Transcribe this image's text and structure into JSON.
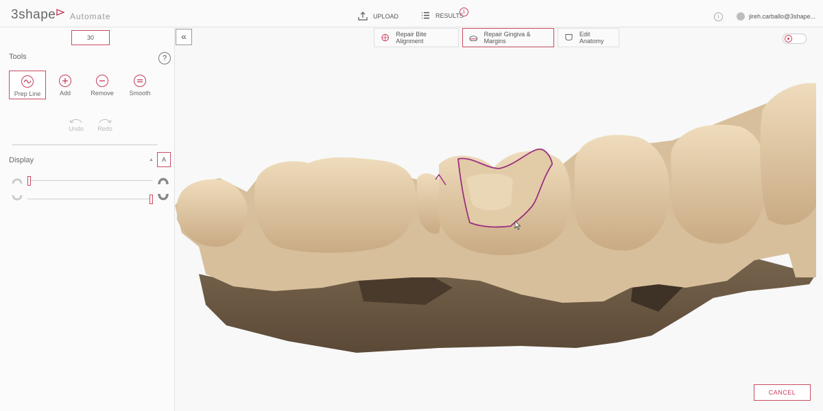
{
  "header": {
    "logo_text": "3shape",
    "app_name": "Automate",
    "upload_label": "UPLOAD",
    "results_label": "RESULTS",
    "results_count": "1",
    "user_email": "jireh.carballo@3shape..."
  },
  "sidebar": {
    "number_value": "30",
    "tools_title": "Tools",
    "tools": [
      {
        "label": "Prep Line",
        "icon": "prep-line-icon",
        "selected": true
      },
      {
        "label": "Add",
        "icon": "add-icon"
      },
      {
        "label": "Remove",
        "icon": "remove-icon"
      },
      {
        "label": "Smooth",
        "icon": "smooth-icon"
      }
    ],
    "undo_label": "Undo",
    "redo_label": "Redo",
    "display_title": "Display",
    "display_toggle_label": "A",
    "sliders": [
      {
        "icon": "arch-icon",
        "level": 0.0
      },
      {
        "icon": "arch-icon",
        "level": 1.0
      }
    ]
  },
  "modes": {
    "tabs": [
      {
        "label": "Repair Bite Alignment",
        "icon": "bite-alignment-icon"
      },
      {
        "label": "Repair Gingiva & Margins",
        "icon": "gingiva-margins-icon",
        "active": true
      },
      {
        "label": "Edit Anatomy",
        "icon": "anatomy-icon"
      }
    ]
  },
  "footer": {
    "cancel_label": "CANCEL"
  },
  "colors": {
    "accent": "#c83a5a",
    "tooth": "#dcc09a",
    "gingiva_base": "#6a5540",
    "margin_line": "#9b2f7e"
  }
}
